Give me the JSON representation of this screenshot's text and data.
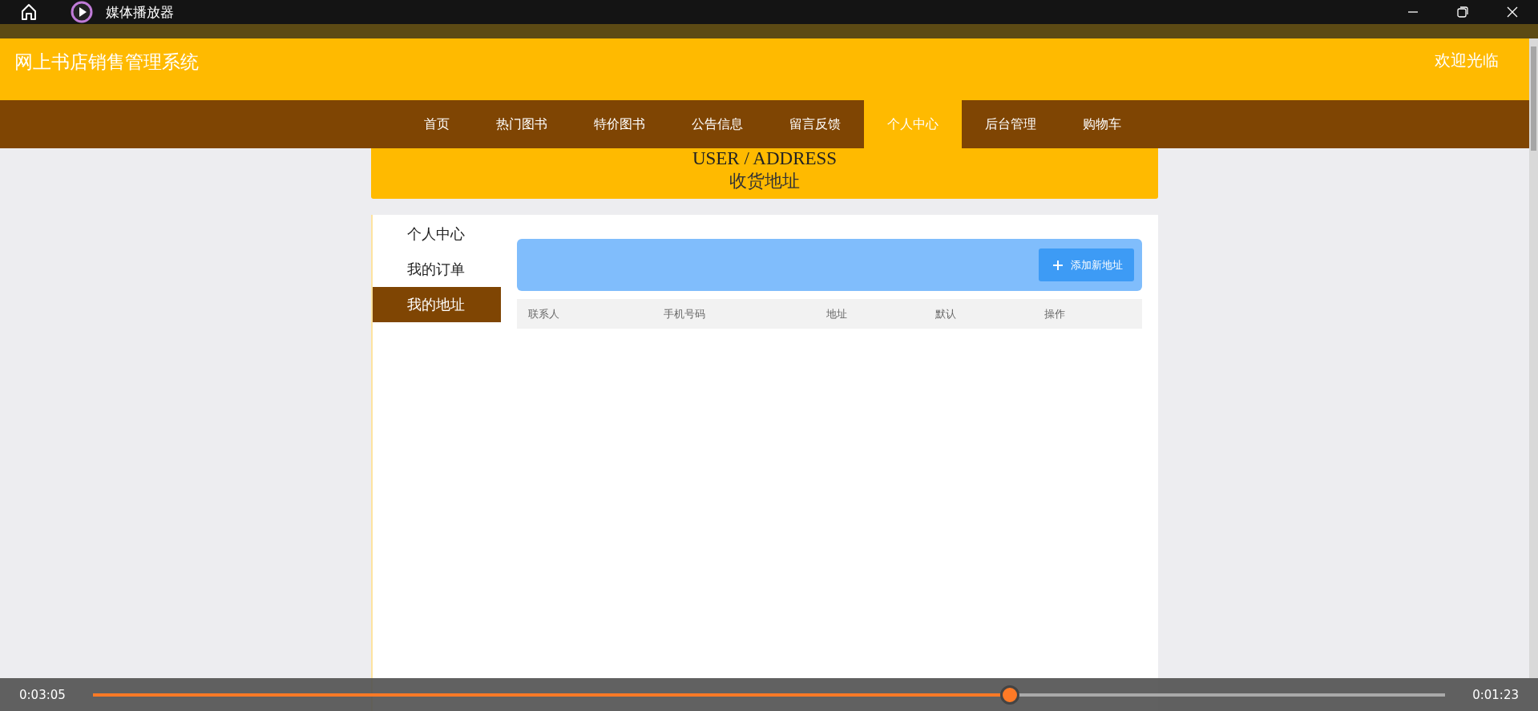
{
  "window": {
    "title": "媒体播放器"
  },
  "site": {
    "title": "网上书店销售管理系统",
    "greeting": "欢迎光临",
    "nav": [
      {
        "label": "首页",
        "selected": false
      },
      {
        "label": "热门图书",
        "selected": false
      },
      {
        "label": "特价图书",
        "selected": false
      },
      {
        "label": "公告信息",
        "selected": false
      },
      {
        "label": "留言反馈",
        "selected": false
      },
      {
        "label": "个人中心",
        "selected": true
      },
      {
        "label": "后台管理",
        "selected": false
      },
      {
        "label": "购物车",
        "selected": false
      }
    ],
    "banner": {
      "english": "USER / ADDRESS",
      "chinese": "收货地址"
    },
    "sidebar": [
      {
        "label": "个人中心",
        "selected": false
      },
      {
        "label": "我的订单",
        "selected": false
      },
      {
        "label": "我的地址",
        "selected": true
      }
    ],
    "add_button": "添加新地址",
    "table": {
      "columns": [
        "联系人",
        "手机号码",
        "地址",
        "默认",
        "操作"
      ]
    }
  },
  "player": {
    "elapsed": "0:03:05",
    "remaining": "0:01:23",
    "level": 0.678
  }
}
